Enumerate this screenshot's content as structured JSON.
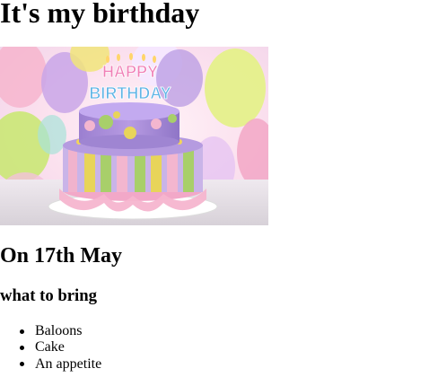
{
  "page": {
    "title": "It's my birthday",
    "date_heading": "On 17th May",
    "bring_heading": "what to bring",
    "bring_items": [
      "Baloons",
      "Cake",
      "An appetite"
    ]
  },
  "image": {
    "cake_top_text": "HAPPY",
    "cake_bottom_text": "BIRTHDAY"
  },
  "colors": {
    "text": "#000000",
    "background": "#ffffff",
    "cake_purple": "#a98fd6",
    "cake_yellow": "#e8d45a",
    "cake_pink": "#f3b6cf",
    "cake_green": "#a8cf6a"
  }
}
